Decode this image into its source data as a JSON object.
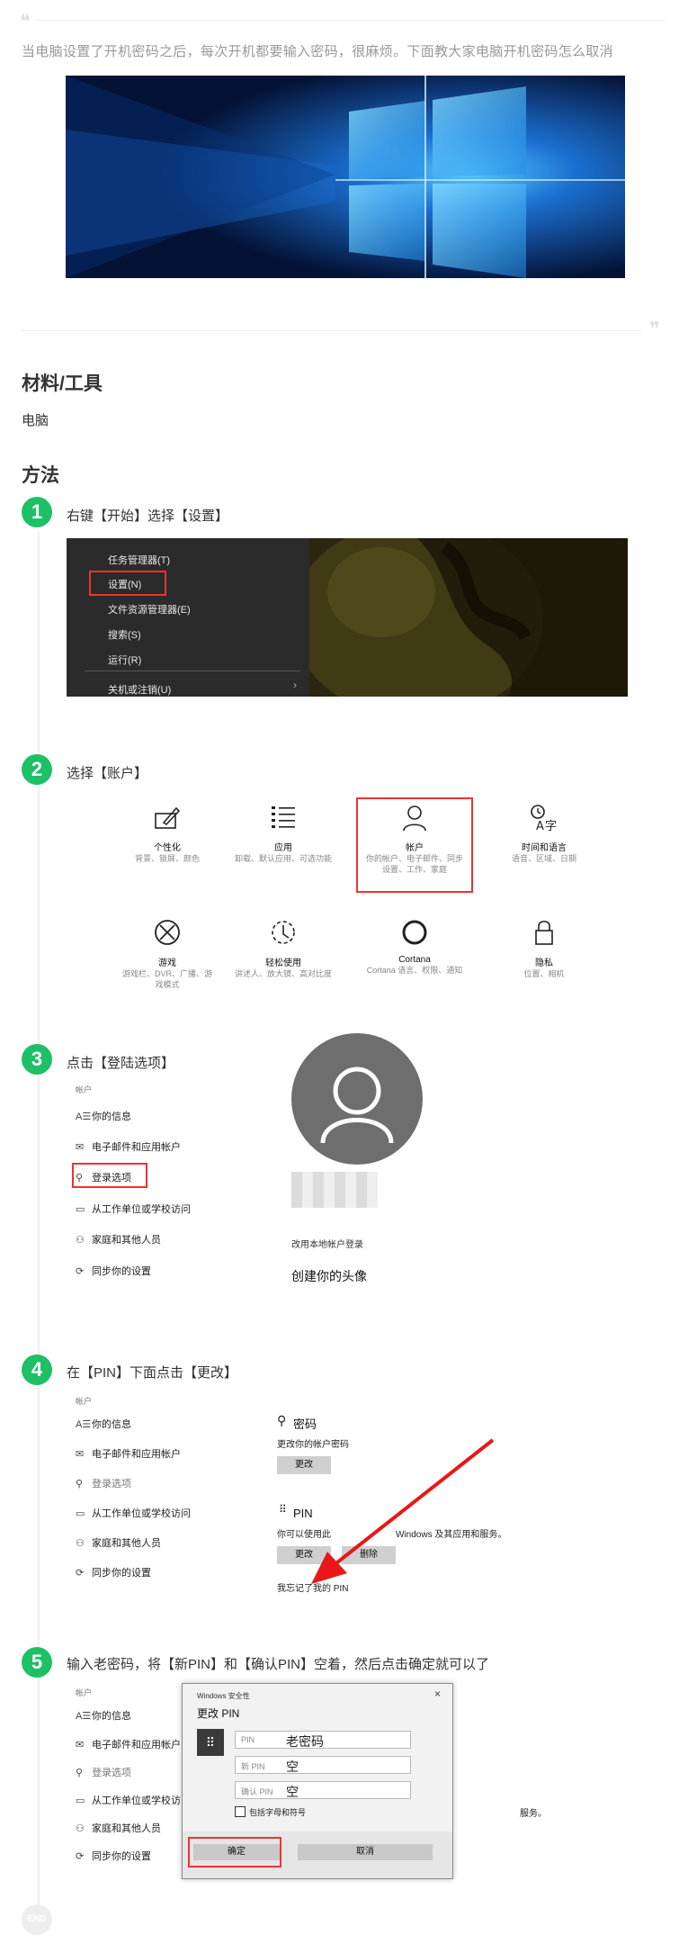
{
  "intro": "当电脑设置了开机密码之后，每次开机都要输入密码，很麻烦。下面教大家电脑开机密码怎么取消",
  "materials": {
    "heading": "材料/工具",
    "item": "电脑"
  },
  "method_heading": "方法",
  "steps": [
    {
      "num": "1",
      "text": "右键【开始】选择【设置】",
      "menu": [
        "任务管理器(T)",
        "设置(N)",
        "文件资源管理器(E)",
        "搜索(S)",
        "运行(R)",
        "关机或注销(U)"
      ]
    },
    {
      "num": "2",
      "text": "选择【账户】",
      "tiles": [
        {
          "title": "个性化",
          "sub": "背景、锁屏、颜色"
        },
        {
          "title": "应用",
          "sub": "卸载、默认应用、可选功能"
        },
        {
          "title": "帐户",
          "sub": "你的帐户、电子邮件、同步设置、工作、家庭"
        },
        {
          "title": "时间和语言",
          "sub": "语音、区域、日期"
        },
        {
          "title": "游戏",
          "sub": "游戏栏、DVR、广播、游戏模式"
        },
        {
          "title": "轻松使用",
          "sub": "讲述人、放大镜、高对比度"
        },
        {
          "title": "Cortana",
          "sub": "Cortana 语言、权限、通知"
        },
        {
          "title": "隐私",
          "sub": "位置、相机"
        }
      ]
    },
    {
      "num": "3",
      "text": "点击【登陆选项】",
      "section": "帐户",
      "items": [
        "你的信息",
        "电子邮件和应用帐户",
        "登录选项",
        "从工作单位或学校访问",
        "家庭和其他人员",
        "同步你的设置"
      ],
      "local_link": "改用本地帐户登录",
      "avatar_title": "创建你的头像"
    },
    {
      "num": "4",
      "text": "在【PIN】下面点击【更改】",
      "section": "帐户",
      "items": [
        "你的信息",
        "电子邮件和应用帐户",
        "登录选项",
        "从工作单位或学校访问",
        "家庭和其他人员",
        "同步你的设置"
      ],
      "password_title": "密码",
      "password_desc": "更改你的帐户密码",
      "change_label": "更改",
      "pin_title": "PIN",
      "pin_desc_left": "你可以使用此",
      "pin_desc_right": "Windows 及其应用和服务。",
      "delete_label": "删除",
      "forgot": "我忘记了我的 PIN"
    },
    {
      "num": "5",
      "text": "输入老密码，将【新PIN】和【确认PIN】空着，然后点击确定就可以了",
      "section": "帐户",
      "items": [
        "你的信息",
        "电子邮件和应用帐户",
        "登录选项",
        "从工作单位或学校访问",
        "家庭和其他人员",
        "同步你的设置"
      ],
      "bg_suffix": "服务。",
      "dialog": {
        "caption": "Windows 安全性",
        "close": "×",
        "title": "更改 PIN",
        "fields": [
          {
            "placeholder": "PIN",
            "value": "老密码"
          },
          {
            "placeholder": "新 PIN",
            "value": "空"
          },
          {
            "placeholder": "确认 PIN",
            "value": "空"
          }
        ],
        "checkbox_label": "包括字母和符号",
        "ok": "确定",
        "cancel": "取消"
      }
    }
  ],
  "end_label": "END",
  "colors": {
    "accent": "#1ec066",
    "highlight": "#e33333"
  }
}
